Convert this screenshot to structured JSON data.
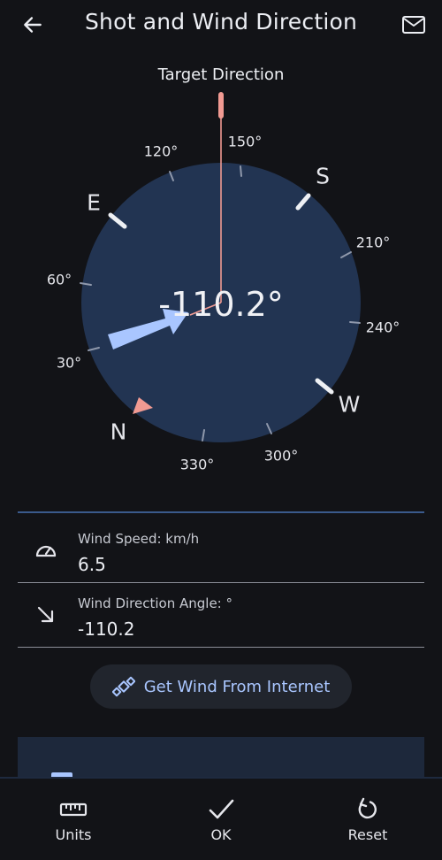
{
  "header": {
    "title": "Shot and Wind Direction",
    "back_icon": "arrow-left-icon",
    "mail_icon": "mail-icon"
  },
  "compass": {
    "target_label": "Target Direction",
    "angle_readout": "-110.2°",
    "cardinals": {
      "e": "E",
      "s": "S",
      "w": "W",
      "n": "N"
    },
    "degree_labels": {
      "d120": "120°",
      "d150": "150°",
      "d210": "210°",
      "d240": "240°",
      "d60": "60°",
      "d30": "30°",
      "d330": "330°",
      "d300": "300°"
    },
    "colors": {
      "dial": "#223452",
      "wind_arrow": "#a9c6ff",
      "target_line": "#f19a92",
      "north_marker": "#f19a92"
    }
  },
  "wind_speed": {
    "label": "Wind Speed: km/h",
    "value": "6.5",
    "icon": "speedometer-icon"
  },
  "wind_direction": {
    "label": "Wind Direction Angle: °",
    "value": "-110.2",
    "icon": "arrow-down-right-icon"
  },
  "internet_button": {
    "label": "Get Wind From Internet",
    "icon": "satellite-icon"
  },
  "bottom_nav": {
    "units": {
      "label": "Units",
      "icon": "ruler-icon"
    },
    "ok": {
      "label": "OK",
      "icon": "checkmark-icon"
    },
    "reset": {
      "label": "Reset",
      "icon": "refresh-icon"
    }
  }
}
